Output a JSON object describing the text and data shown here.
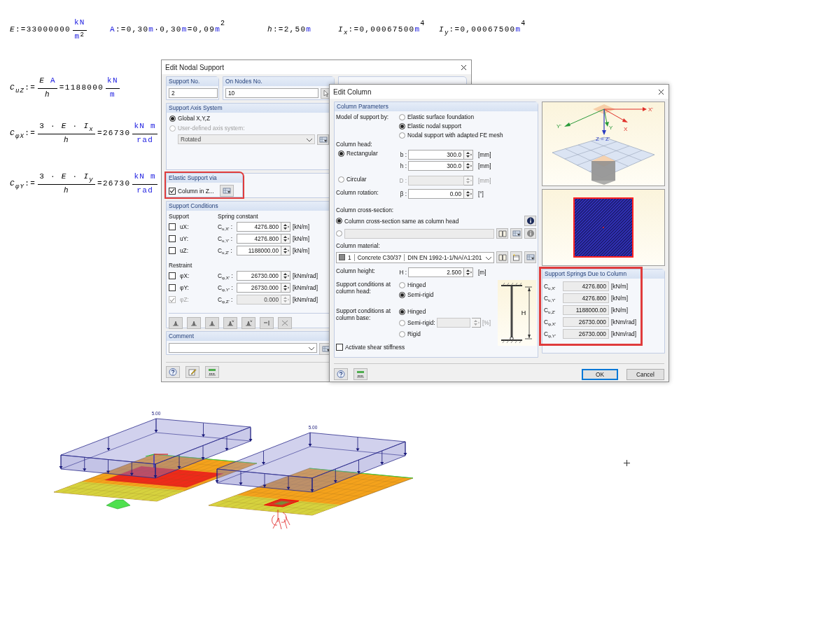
{
  "top_equations": [
    {
      "parts": [
        {
          "kind": "var",
          "t": "E"
        },
        {
          "kind": "op",
          "t": ":="
        },
        {
          "kind": "num",
          "t": "33000000"
        },
        {
          "kind": "frac",
          "num": [
            {
              "kind": "unit",
              "t": "kN"
            }
          ],
          "den": [
            {
              "kind": "unit",
              "t": "m"
            },
            {
              "kind": "sup",
              "t": "2"
            }
          ]
        }
      ]
    },
    {
      "parts": [
        {
          "kind": "name",
          "t": "A"
        },
        {
          "kind": "op",
          "t": ":="
        },
        {
          "kind": "num",
          "t": "0,30"
        },
        {
          "kind": "unit",
          "t": "m"
        },
        {
          "kind": "op",
          "t": "·"
        },
        {
          "kind": "num",
          "t": "0,30"
        },
        {
          "kind": "unit",
          "t": "m"
        },
        {
          "kind": "op",
          "t": "="
        },
        {
          "kind": "num",
          "t": "0,09"
        },
        {
          "kind": "unit",
          "t": "m"
        },
        {
          "kind": "sup",
          "t": "2"
        }
      ]
    },
    {
      "parts": [
        {
          "kind": "var",
          "t": "h"
        },
        {
          "kind": "op",
          "t": ":="
        },
        {
          "kind": "num",
          "t": "2,50"
        },
        {
          "kind": "unit",
          "t": "m"
        }
      ]
    },
    {
      "parts": [
        {
          "kind": "var",
          "t": "I",
          "sub": "x"
        },
        {
          "kind": "op",
          "t": ":="
        },
        {
          "kind": "num",
          "t": "0,00067500"
        },
        {
          "kind": "unit",
          "t": "m"
        },
        {
          "kind": "sup",
          "t": "4"
        }
      ]
    },
    {
      "parts": [
        {
          "kind": "var",
          "t": "I",
          "sub": "y"
        },
        {
          "kind": "op",
          "t": ":="
        },
        {
          "kind": "num",
          "t": "0,00067500"
        },
        {
          "kind": "unit",
          "t": "m"
        },
        {
          "kind": "sup",
          "t": "4"
        }
      ]
    }
  ],
  "side_equations": [
    {
      "parts": [
        {
          "kind": "var",
          "t": "C",
          "sub": "uZ"
        },
        {
          "kind": "op",
          "t": ":="
        },
        {
          "kind": "frac",
          "num": [
            {
              "kind": "var",
              "t": "E"
            },
            {
              "kind": "name",
              "t": "A"
            }
          ],
          "den": [
            {
              "kind": "var",
              "t": "h"
            }
          ]
        },
        {
          "kind": "op",
          "t": "="
        },
        {
          "kind": "num",
          "t": "1188000"
        },
        {
          "kind": "frac",
          "num": [
            {
              "kind": "unit",
              "t": "kN"
            }
          ],
          "den": [
            {
              "kind": "unit",
              "t": "m"
            }
          ]
        }
      ]
    },
    {
      "parts": [
        {
          "kind": "var",
          "t": "C",
          "sub": "φX"
        },
        {
          "kind": "op",
          "t": ":="
        },
        {
          "kind": "frac",
          "num": [
            {
              "kind": "num",
              "t": "3"
            },
            {
              "kind": "op",
              "t": "·"
            },
            {
              "kind": "var",
              "t": "E"
            },
            {
              "kind": "op",
              "t": "·"
            },
            {
              "kind": "var",
              "t": "I",
              "sub": "x"
            }
          ],
          "den": [
            {
              "kind": "var",
              "t": "h"
            }
          ]
        },
        {
          "kind": "op",
          "t": "="
        },
        {
          "kind": "num",
          "t": "26730"
        },
        {
          "kind": "frac",
          "num": [
            {
              "kind": "unit",
              "t": "kN m"
            }
          ],
          "den": [
            {
              "kind": "unit",
              "t": "rad"
            }
          ]
        }
      ]
    },
    {
      "parts": [
        {
          "kind": "var",
          "t": "C",
          "sub": "φY"
        },
        {
          "kind": "op",
          "t": ":="
        },
        {
          "kind": "frac",
          "num": [
            {
              "kind": "num",
              "t": "3"
            },
            {
              "kind": "op",
              "t": "·"
            },
            {
              "kind": "var",
              "t": "E"
            },
            {
              "kind": "op",
              "t": "·"
            },
            {
              "kind": "var",
              "t": "I",
              "sub": "y"
            }
          ],
          "den": [
            {
              "kind": "var",
              "t": "h"
            }
          ]
        },
        {
          "kind": "op",
          "t": "="
        },
        {
          "kind": "num",
          "t": "26730"
        },
        {
          "kind": "frac",
          "num": [
            {
              "kind": "unit",
              "t": "kN m"
            }
          ],
          "den": [
            {
              "kind": "unit",
              "t": "rad"
            }
          ]
        }
      ]
    }
  ],
  "nodal_dialog": {
    "title": "Edit Nodal Support",
    "support_no": {
      "title": "Support No.",
      "value": "2"
    },
    "nodes": {
      "title": "On Nodes No.",
      "value": "10"
    },
    "axis_system": {
      "title": "Support Axis System",
      "options": [
        {
          "label": "Global X,Y,Z",
          "selected": true,
          "disabled": false
        },
        {
          "label": "User-defined axis system:",
          "selected": false,
          "disabled": true
        }
      ],
      "dropdown": {
        "value": "Rotated",
        "disabled": true
      }
    },
    "elastic": {
      "title": "Elastic Support via",
      "highlighted": true,
      "checkbox": {
        "label": "Column in Z...",
        "checked": true
      }
    },
    "conditions": {
      "title": "Support Conditions",
      "support_heading": "Support",
      "spring_heading": "Spring constant",
      "support_rows": [
        {
          "label": "uX:",
          "checked": false,
          "disabled": false,
          "symbol": "C$_{u,X'}$ :",
          "value": "4276.800",
          "unit": "[kN/m]"
        },
        {
          "label": "uY:",
          "checked": false,
          "disabled": false,
          "symbol": "C$_{u,Y'}$ :",
          "value": "4276.800",
          "unit": "[kN/m]"
        },
        {
          "label": "uZ:",
          "checked": false,
          "disabled": false,
          "symbol": "C$_{u,Z'}$ :",
          "value": "1188000.00",
          "unit": "[kN/m]"
        }
      ],
      "restraint_heading": "Restraint",
      "restraint_rows": [
        {
          "label": "φX:",
          "checked": false,
          "disabled": false,
          "symbol": "C$_{φ,X'}$ :",
          "value": "26730.000",
          "unit": "[kNm/rad]"
        },
        {
          "label": "φY:",
          "checked": false,
          "disabled": false,
          "symbol": "C$_{φ,Y'}$ :",
          "value": "26730.000",
          "unit": "[kNm/rad]"
        },
        {
          "label": "φZ:",
          "checked": true,
          "disabled": true,
          "symbol": "C$_{φ,Z'}$ :",
          "value": "0.000",
          "unit": "[kNm/rad]"
        }
      ]
    },
    "comment": {
      "title": "Comment"
    }
  },
  "column_dialog": {
    "title": "Edit Column",
    "section_title": "Column Parameters",
    "model": {
      "label": "Model of support by:",
      "options": [
        {
          "label": "Elastic surface foundation",
          "selected": false
        },
        {
          "label": "Elastic nodal support",
          "selected": true
        },
        {
          "label": "Nodal support with adapted FE mesh",
          "selected": false
        }
      ]
    },
    "head_label": "Column head:",
    "head_shapes": [
      {
        "label": "Rectangular",
        "selected": true,
        "dims": [
          {
            "symbol": "b :",
            "value": "300.0",
            "unit": "[mm]",
            "disabled": false
          },
          {
            "symbol": "h :",
            "value": "300.0",
            "unit": "[mm]",
            "disabled": false
          }
        ]
      },
      {
        "label": "Circular",
        "selected": false,
        "dims": [
          {
            "symbol": "D :",
            "unit": "[mm]",
            "disabled": true
          }
        ]
      }
    ],
    "rotation": {
      "label": "Column rotation:",
      "symbol": "β :",
      "value": "0.00",
      "unit": "[°]"
    },
    "cross_section": {
      "label": "Column cross-section:",
      "options": [
        {
          "label": "Column cross-section same as column head",
          "selected": true
        },
        {
          "selected": false
        }
      ]
    },
    "material": {
      "label": "Column material:",
      "number": "1",
      "name": "Concrete C30/37",
      "standard": "DIN EN 1992-1-1/NA/A1:201"
    },
    "height": {
      "label": "Column height:",
      "symbol": "H :",
      "value": "2.500",
      "unit": "[m]"
    },
    "head_conditions": {
      "label": "Support conditions at column head:",
      "options": [
        {
          "label": "Hinged",
          "selected": false
        },
        {
          "label": "Semi-rigid",
          "selected": true
        }
      ]
    },
    "base_conditions": {
      "label": "Support conditions at column base:",
      "options": [
        {
          "label": "Hinged",
          "selected": true
        },
        {
          "label": "Semi-rigid:",
          "selected": false,
          "unit": "[%]"
        },
        {
          "label": "Rigid",
          "selected": false
        }
      ]
    },
    "figure_label": "H",
    "shear": {
      "label": "Activate shear stiffness",
      "checked": false
    },
    "axis_labels": [
      "X'",
      "X",
      "Y'",
      "Y",
      "Z = Z'"
    ],
    "springs": {
      "title": "Support Springs Due to Column",
      "highlighted": true,
      "rows": [
        {
          "symbol": "C$_{u,X'}$",
          "value": "4276.800",
          "unit": "[kN/m]"
        },
        {
          "symbol": "C$_{u,Y'}$",
          "value": "4276.800",
          "unit": "[kN/m]"
        },
        {
          "symbol": "C$_{u,Z'}$",
          "value": "1188000.00",
          "unit": "[kN/m]"
        },
        {
          "symbol": "C$_{φ,X'}$",
          "value": "26730.000",
          "unit": "[kNm/rad]"
        },
        {
          "symbol": "C$_{φ,Y'}$",
          "value": "26730.000",
          "unit": "[kNm/rad]"
        }
      ]
    },
    "buttons": [
      {
        "label": "OK",
        "default": true
      },
      {
        "label": "Cancel",
        "default": false
      }
    ]
  },
  "model_views": [
    {
      "load_label": "5.00"
    },
    {
      "load_label": "5.00"
    }
  ]
}
